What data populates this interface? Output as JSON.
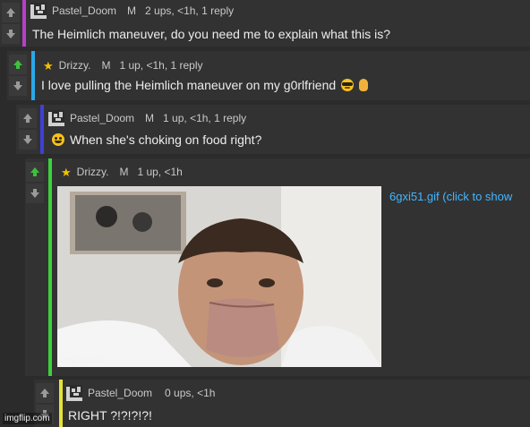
{
  "comments": [
    {
      "user": "Pastel_Doom",
      "badge": "M",
      "meta": "2 ups, <1h, 1 reply",
      "text": "The Heimlich maneuver, do you need me to explain what this is?",
      "bar_color": "#b83fc7"
    },
    {
      "user": "Drizzy.",
      "badge": "M",
      "meta": "1 up, <1h, 1 reply",
      "text": "I love pulling the Heimlich maneuver on my g0rlfriend",
      "bar_color": "#2aa8e8"
    },
    {
      "user": "Pastel_Doom",
      "badge": "M",
      "meta": "1 up, <1h, 1 reply",
      "text": "When she's choking on food right?",
      "bar_color": "#3f3fd8"
    },
    {
      "user": "Drizzy.",
      "badge": "M",
      "meta": "1 up, <1h",
      "gif_label": "6gxi51.gif (click to show",
      "image_watermark": "imgflip.com",
      "bar_color": "#3bd13b"
    },
    {
      "user": "Pastel_Doom",
      "badge": "",
      "meta": "0 ups, <1h",
      "text": "RIGHT ?!?!?!?!",
      "bar_color": "#e3e33a"
    }
  ],
  "site_watermark": "imgflip.com",
  "icons": {
    "upvote": "up-arrow-icon",
    "downvote": "down-arrow-icon",
    "avatar": "pixel-avatar-icon",
    "star": "star-icon"
  },
  "colors": {
    "upvote_active": "#3cc13c",
    "vote_default": "#9a9a9a",
    "link": "#44b6ff"
  }
}
